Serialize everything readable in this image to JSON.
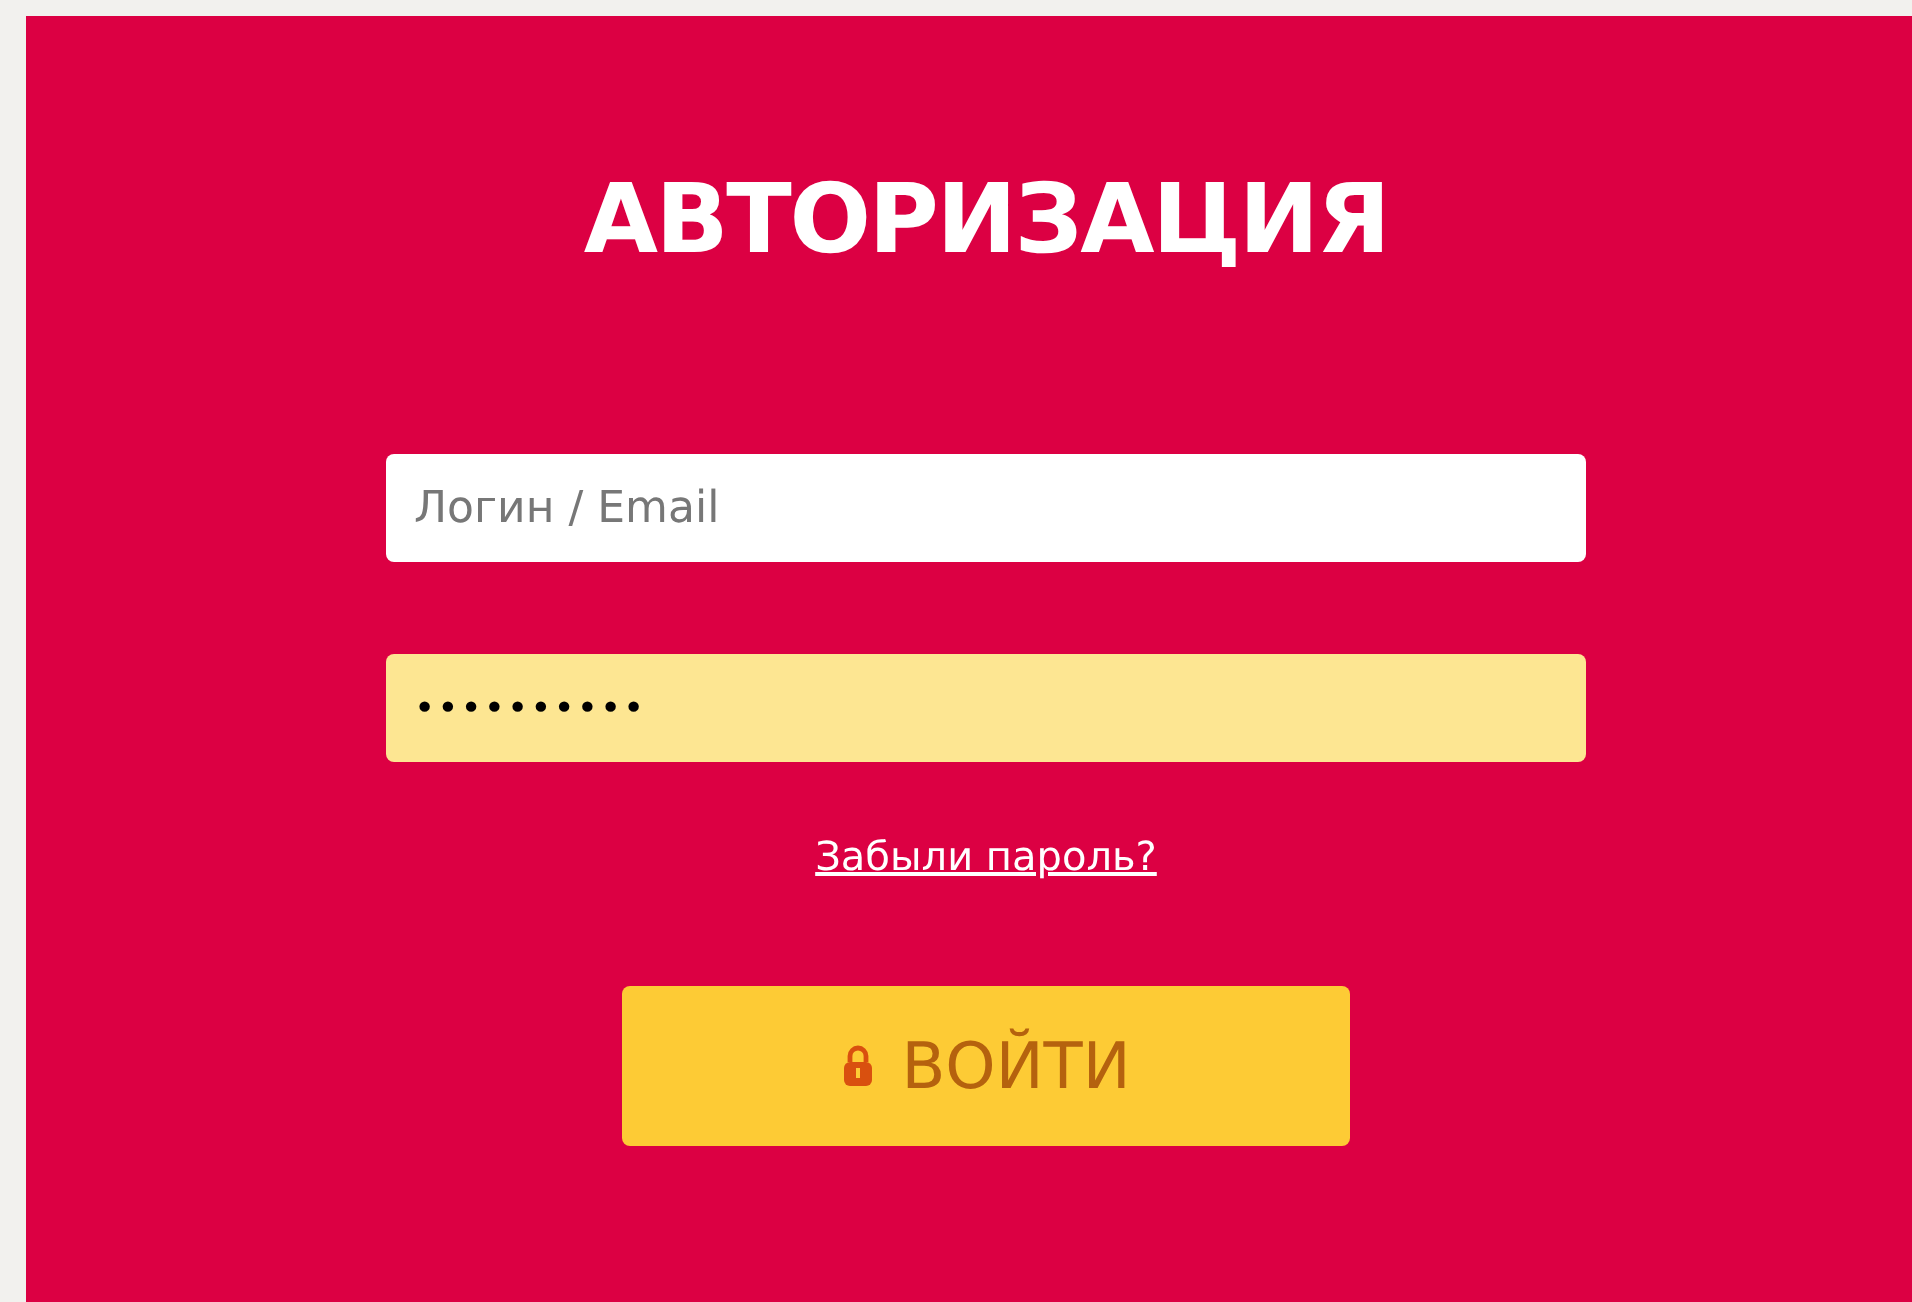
{
  "title": "АВТОРИЗАЦИЯ",
  "login_field": {
    "placeholder": "Логин / Email"
  },
  "password_field": {
    "value": "••••••••••",
    "autofilled": true
  },
  "forgot_link": "Забыли пароль?",
  "submit_button": {
    "label": "ВОЙТИ"
  }
}
